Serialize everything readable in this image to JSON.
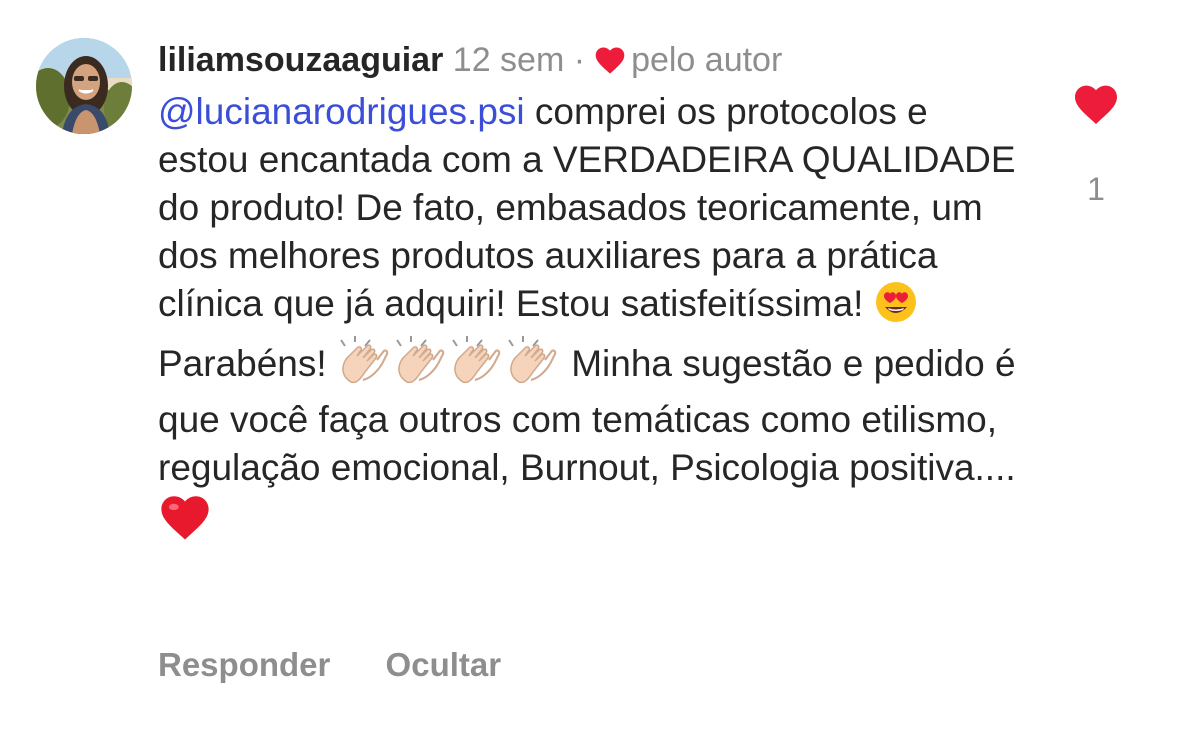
{
  "comment": {
    "username": "liliamsouzaaguiar",
    "time_ago": "12 sem",
    "separator": "·",
    "liked_by_author_label": "pelo autor",
    "mention": "@lucianarodrigues.psi",
    "text_part1": " comprei os protocolos e estou encantada com a VERDADEIRA QUALIDADE do produto! De fato, embasados teoricamente, um dos melhores produtos auxiliares para a prática clínica que já adquiri! Estou satisfeitíssima! ",
    "text_part2": " Parabéns! ",
    "text_part3": " Minha sugestão e pedido é que você faça outros com temáticas como etilismo, regulação emocional, Burnout, Psicologia positiva.... ",
    "emojis": {
      "heart_eyes": "smiling-face-with-heart-eyes",
      "clap": "clapping-hands-light-skin",
      "clap_count": 4,
      "red_heart": "red-heart"
    }
  },
  "actions": {
    "reply_label": "Responder",
    "hide_label": "Ocultar"
  },
  "like": {
    "count": "1",
    "icon": "filled-heart-icon",
    "liked": true
  },
  "colors": {
    "heart_red": "#ed1c3a",
    "mention_blue": "#3b4ed8",
    "secondary_text": "#8e8e8e",
    "primary_text": "#262626"
  }
}
